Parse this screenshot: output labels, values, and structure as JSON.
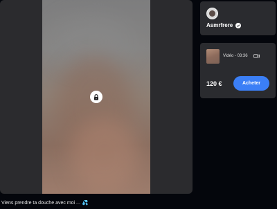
{
  "creator": {
    "name": "Asmrfrere",
    "avatar_icon": "avatar",
    "verified_icon": "check-badge-icon"
  },
  "media": {
    "locked_icon": "lock-icon",
    "caption": "Viens prendre ta douche avec moi ...",
    "caption_emoji": "💦"
  },
  "offer": {
    "type_label": "Vidéo - 03:36",
    "type_icon": "video-camera-icon",
    "price": "120 €",
    "buy_label": "Acheter"
  },
  "colors": {
    "accent": "#3b7ff6",
    "card_bg": "#2a2b2f",
    "page_bg": "#04060c"
  }
}
